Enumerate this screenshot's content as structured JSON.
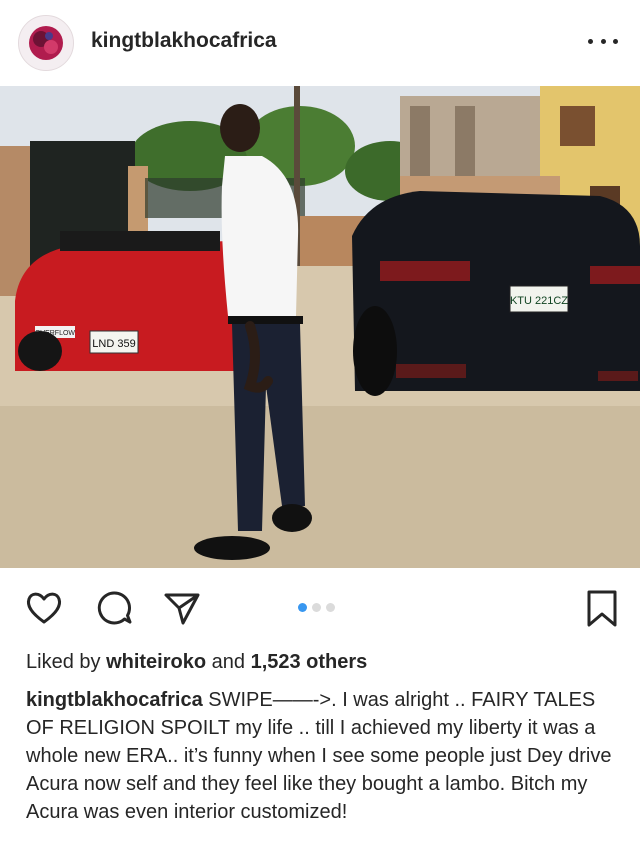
{
  "post": {
    "username": "kingtblakhocafrica",
    "photo": {
      "plate_left": "LND 359",
      "plate_right": "KTU 221CZ",
      "frame_left": "OVERFLOW"
    },
    "carousel": {
      "count": 3,
      "active_index": 0
    },
    "liked_by_prefix": "Liked by",
    "liked_by_user": "whiteiroko",
    "liked_by_middle": "and",
    "liked_by_count": "1,523 others",
    "caption_user": "kingtblakhocafrica",
    "caption_text": "SWIPE——->. I was alright .. FAIRY TALES OF RELIGION SPOILT  my life .. till I achieved my liberty it was a whole new ERA.. it’s funny when I see some people just Dey drive Acura now self and they feel like they bought a lambo. Bitch my Acura was even interior customized!"
  },
  "icons": [
    "more-options-icon",
    "heart-icon",
    "comment-icon",
    "share-icon",
    "bookmark-icon"
  ],
  "colors": {
    "accent": "#3897f0",
    "text": "#262626",
    "dot_inactive": "#dbdbdb"
  }
}
